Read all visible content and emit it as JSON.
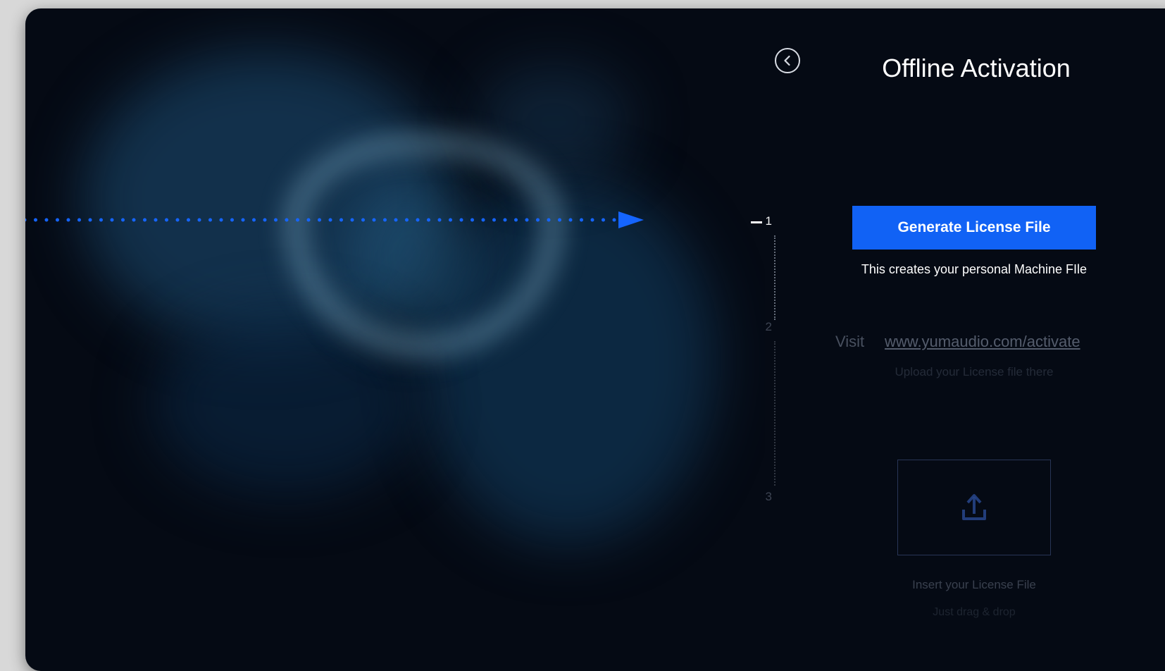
{
  "header": {
    "title": "Offline Activation",
    "back_icon": "chevron-left-circle-icon"
  },
  "stepper": {
    "steps": [
      "1",
      "2",
      "3"
    ],
    "active_step": 1
  },
  "step1": {
    "button_label": "Generate License File",
    "caption": "This creates your personal Machine FIle"
  },
  "step2": {
    "visit_label": "Visit",
    "link_text": "www.yumaudio.com/activate",
    "hint": "Upload your License file there"
  },
  "step3": {
    "drop_icon": "upload-icon",
    "label": "Insert your License File",
    "hint": "Just drag & drop"
  },
  "colors": {
    "accent": "#1162f5",
    "background": "#050a14"
  }
}
